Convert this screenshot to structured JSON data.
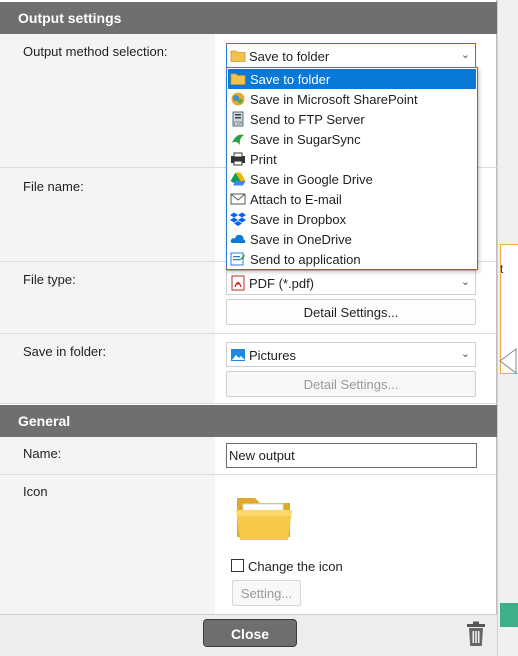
{
  "output_settings": {
    "header": "Output settings",
    "method_label": "Output method selection:",
    "method_value": "Save to folder",
    "method_options": [
      {
        "label": "Save to folder",
        "icon": "folder-icon",
        "selected": true
      },
      {
        "label": "Save in Microsoft SharePoint",
        "icon": "sharepoint-icon",
        "selected": false
      },
      {
        "label": "Send to FTP Server",
        "icon": "ftp-server-icon",
        "selected": false
      },
      {
        "label": "Save in SugarSync",
        "icon": "sugarsync-icon",
        "selected": false
      },
      {
        "label": "Print",
        "icon": "printer-icon",
        "selected": false
      },
      {
        "label": "Save in Google Drive",
        "icon": "google-drive-icon",
        "selected": false
      },
      {
        "label": "Attach to E-mail",
        "icon": "envelope-icon",
        "selected": false
      },
      {
        "label": "Save in Dropbox",
        "icon": "dropbox-icon",
        "selected": false
      },
      {
        "label": "Save in OneDrive",
        "icon": "onedrive-icon",
        "selected": false
      },
      {
        "label": "Send to application",
        "icon": "application-icon",
        "selected": false
      }
    ],
    "file_name_label": "File name:",
    "file_type_label": "File type:",
    "file_type_value": "PDF (*.pdf)",
    "file_type_detail": "Detail Settings...",
    "folder_label": "Save in folder:",
    "folder_value": "Pictures",
    "folder_detail": "Detail Settings..."
  },
  "general": {
    "header": "General",
    "name_label": "Name:",
    "name_value": "New output",
    "icon_label": "Icon",
    "change_icon_label": "Change the icon",
    "change_icon_checked": false,
    "setting_button": "Setting..."
  },
  "footer": {
    "close_label": "Close"
  },
  "background": {
    "strip_text": "t"
  },
  "colors": {
    "header_bg": "#6f6f6f",
    "selection": "#0a78d7",
    "focus_border": "#2b7cd3",
    "accent_orange": "#f0a64a",
    "accent_green": "#3fae8a"
  }
}
